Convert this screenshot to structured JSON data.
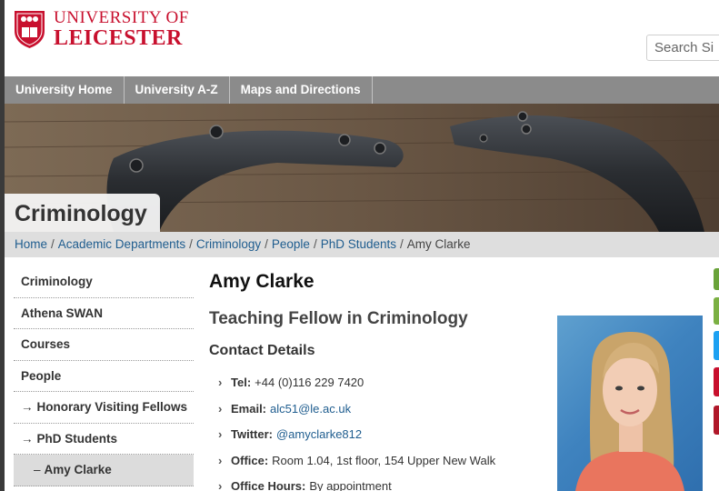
{
  "header": {
    "logo_line1": "UNIVERSITY OF",
    "logo_line2": "LEICESTER",
    "search_placeholder": "Search Si"
  },
  "topnav": {
    "items": [
      "University Home",
      "University A-Z",
      "Maps and Directions"
    ]
  },
  "banner": {
    "title": "Criminology"
  },
  "breadcrumb": {
    "items": [
      "Home",
      "Academic Departments",
      "Criminology",
      "People",
      "PhD Students"
    ],
    "current": "Amy Clarke"
  },
  "sidebar": {
    "items": [
      {
        "label": "Criminology",
        "prefix": ""
      },
      {
        "label": "Athena SWAN",
        "prefix": ""
      },
      {
        "label": "Courses",
        "prefix": ""
      },
      {
        "label": "People",
        "prefix": ""
      },
      {
        "label": "Honorary Visiting Fellows",
        "prefix": "→"
      },
      {
        "label": "PhD Students",
        "prefix": "→"
      },
      {
        "label": "Amy Clarke",
        "prefix": "–"
      }
    ]
  },
  "profile": {
    "name": "Amy Clarke",
    "title": "Teaching Fellow in Criminology",
    "contact_heading": "Contact Details",
    "contacts": [
      {
        "label": "Tel:",
        "value": "+44 (0)116 229 7420"
      },
      {
        "label": "Email:",
        "value": "alc51@le.ac.uk"
      },
      {
        "label": "Twitter:",
        "value": "@amyclarke812"
      },
      {
        "label": "Office:",
        "value": "Room 1.04, 1st floor, 154 Upper New Walk"
      },
      {
        "label": "Office Hours:",
        "value": "By appointment"
      }
    ]
  },
  "colors": {
    "brand_red": "#c8102e",
    "link_blue": "#1f5d8f",
    "nav_grey": "#8b8b8b"
  }
}
